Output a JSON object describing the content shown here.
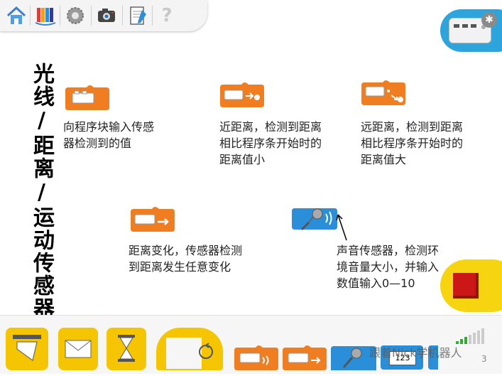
{
  "toolbar": {
    "items": [
      {
        "name": "home-icon"
      },
      {
        "name": "library-icon"
      },
      {
        "name": "settings-icon"
      },
      {
        "name": "camera-icon"
      },
      {
        "name": "notebook-icon"
      },
      {
        "name": "help-icon",
        "glyph": "?"
      }
    ]
  },
  "title": "光线/距离/运动传感器",
  "blocks": [
    {
      "desc": "向程序块输入传感器检测到的值"
    },
    {
      "desc": "近距离，检测到距离相比程序条开始时的距离值小"
    },
    {
      "desc": "远距离，检测到距离相比程序条开始时的距离值大"
    },
    {
      "desc": "距离变化，传感器检测到距离发生任意变化"
    },
    {
      "desc": "声音传感器，检测环境音量大小，并输入数值输入0—10"
    }
  ],
  "hub": {
    "bt_glyph": "✱"
  },
  "palette": {
    "label_123": "123"
  },
  "page_number": "3",
  "watermark": "跟着Nick学机器人",
  "colors": {
    "orange": "#f07d1f",
    "blue": "#2a8fd8",
    "yellow": "#f4c500",
    "stop": "#cc1717"
  }
}
